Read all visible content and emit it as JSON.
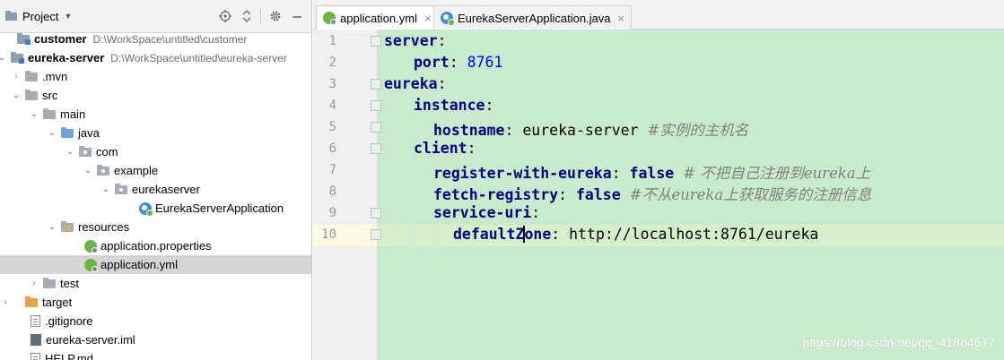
{
  "project_panel": {
    "title": "Project",
    "toolbar_icons": [
      "locate-icon",
      "collapse-icon",
      "gear-icon",
      "hide-icon"
    ],
    "tree": [
      {
        "label": "customer",
        "path": "D:\\WorkSpace\\untitled\\customer",
        "icon": "module-folder-icon",
        "bold": true
      },
      {
        "label": "eureka-server",
        "path": "D:\\WorkSpace\\untitled\\eureka-server",
        "icon": "module-folder-icon",
        "bold": true,
        "expanded": true
      },
      {
        "label": ".mvn",
        "icon": "folder-icon",
        "expanded": false
      },
      {
        "label": "src",
        "icon": "folder-icon",
        "expanded": true
      },
      {
        "label": "main",
        "icon": "folder-icon",
        "expanded": true
      },
      {
        "label": "java",
        "icon": "source-folder-icon",
        "expanded": true
      },
      {
        "label": "com",
        "icon": "package-icon",
        "expanded": true
      },
      {
        "label": "example",
        "icon": "package-icon",
        "expanded": true
      },
      {
        "label": "eurekaserver",
        "icon": "package-icon",
        "expanded": true
      },
      {
        "label": "EurekaServerApplication",
        "icon": "spring-class-icon"
      },
      {
        "label": "resources",
        "icon": "resources-folder-icon",
        "expanded": true
      },
      {
        "label": "application.properties",
        "icon": "spring-config-icon"
      },
      {
        "label": "application.yml",
        "icon": "spring-config-icon",
        "selected": true
      },
      {
        "label": "test",
        "icon": "folder-icon",
        "expanded": false
      },
      {
        "label": "target",
        "icon": "excluded-folder-icon",
        "expanded": false
      },
      {
        "label": ".gitignore",
        "icon": "file-icon"
      },
      {
        "label": "eureka-server.iml",
        "icon": "iml-file-icon"
      },
      {
        "label": "HELP.md",
        "icon": "file-icon"
      }
    ]
  },
  "editor": {
    "tabs": [
      {
        "label": "application.yml",
        "active": true
      },
      {
        "label": "EurekaServerApplication.java",
        "active": false
      }
    ],
    "line_numbers": [
      "1",
      "2",
      "3",
      "4",
      "5",
      "6",
      "7",
      "8",
      "9",
      "10"
    ],
    "lines": {
      "l1_key": "server",
      "l2_key": "port",
      "l2_val": "8761",
      "l3_key": "eureka",
      "l4_key": "instance",
      "l5_key": "hostname",
      "l5_val": "eureka-server",
      "l5_cmt": "#实例的主机名",
      "l6_key": "client",
      "l7_key": "register-with-eureka",
      "l7_val": "false",
      "l7_cmt": "# 不把自己注册到eureka上",
      "l8_key": "fetch-registry",
      "l8_val": "false",
      "l8_cmt": "#不从eureka上获取服务的注册信息",
      "l9_key": "service-uri",
      "l10_key_a": "defaultZ",
      "l10_key_b": "one",
      "l10_val": "http://localhost:8761/eureka"
    },
    "colon": ":"
  },
  "watermark": "https://blog.csdn.net/qq_41884677",
  "colors": {
    "code_background": "#c8ebcc",
    "key_color": "#000080",
    "number_color": "#0000ff",
    "comment_color": "#808080",
    "selection": "#d5d5d5"
  }
}
